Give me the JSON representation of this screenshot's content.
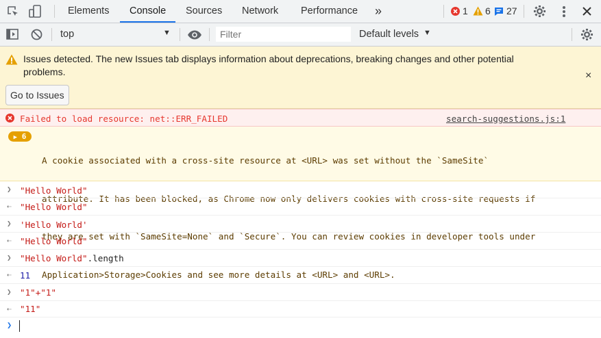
{
  "tabs": [
    {
      "label": "Elements"
    },
    {
      "label": "Console"
    },
    {
      "label": "Sources"
    },
    {
      "label": "Network"
    },
    {
      "label": "Performance"
    }
  ],
  "more_tabs_label": "»",
  "counters": {
    "errors": "1",
    "warnings": "6",
    "messages": "27"
  },
  "toolbar": {
    "context": "top",
    "filter_placeholder": "Filter",
    "levels": "Default levels"
  },
  "banner": {
    "text": "Issues detected. The new Issues tab displays information about deprecations, breaking changes and other potential problems.",
    "button": "Go to Issues",
    "close": "×"
  },
  "error": {
    "message": "Failed to load resource: net::ERR_FAILED",
    "source": "search-suggestions.js:1"
  },
  "warning": {
    "count": "6",
    "lines": [
      "A cookie associated with a cross-site resource at <URL> was set without the `SameSite`",
      "attribute. It has been blocked, as Chrome now only delivers cookies with cross-site requests if",
      "they are set with `SameSite=None` and `Secure`. You can review cookies in developer tools under",
      "Application>Storage>Cookies and see more details at <URL> and <URL>."
    ]
  },
  "entries": [
    {
      "input": "\"Hello World\"",
      "input_suffix": "",
      "output": "\"Hello World\"",
      "output_kind": "str"
    },
    {
      "input": "'Hello World'",
      "input_suffix": "",
      "output": "\"Hello World\"",
      "output_kind": "str"
    },
    {
      "input": "\"Hello World\"",
      "input_suffix": ".length",
      "output": "11",
      "output_kind": "num"
    },
    {
      "input": "\"1\"+\"1\"",
      "input_suffix": "",
      "output": "\"11\"",
      "output_kind": "str"
    }
  ],
  "colors": {
    "accent": "#1a73e8",
    "error": "#e6372e",
    "warning": "#e5a000",
    "string": "#c41a16",
    "number": "#1a1aa6"
  }
}
